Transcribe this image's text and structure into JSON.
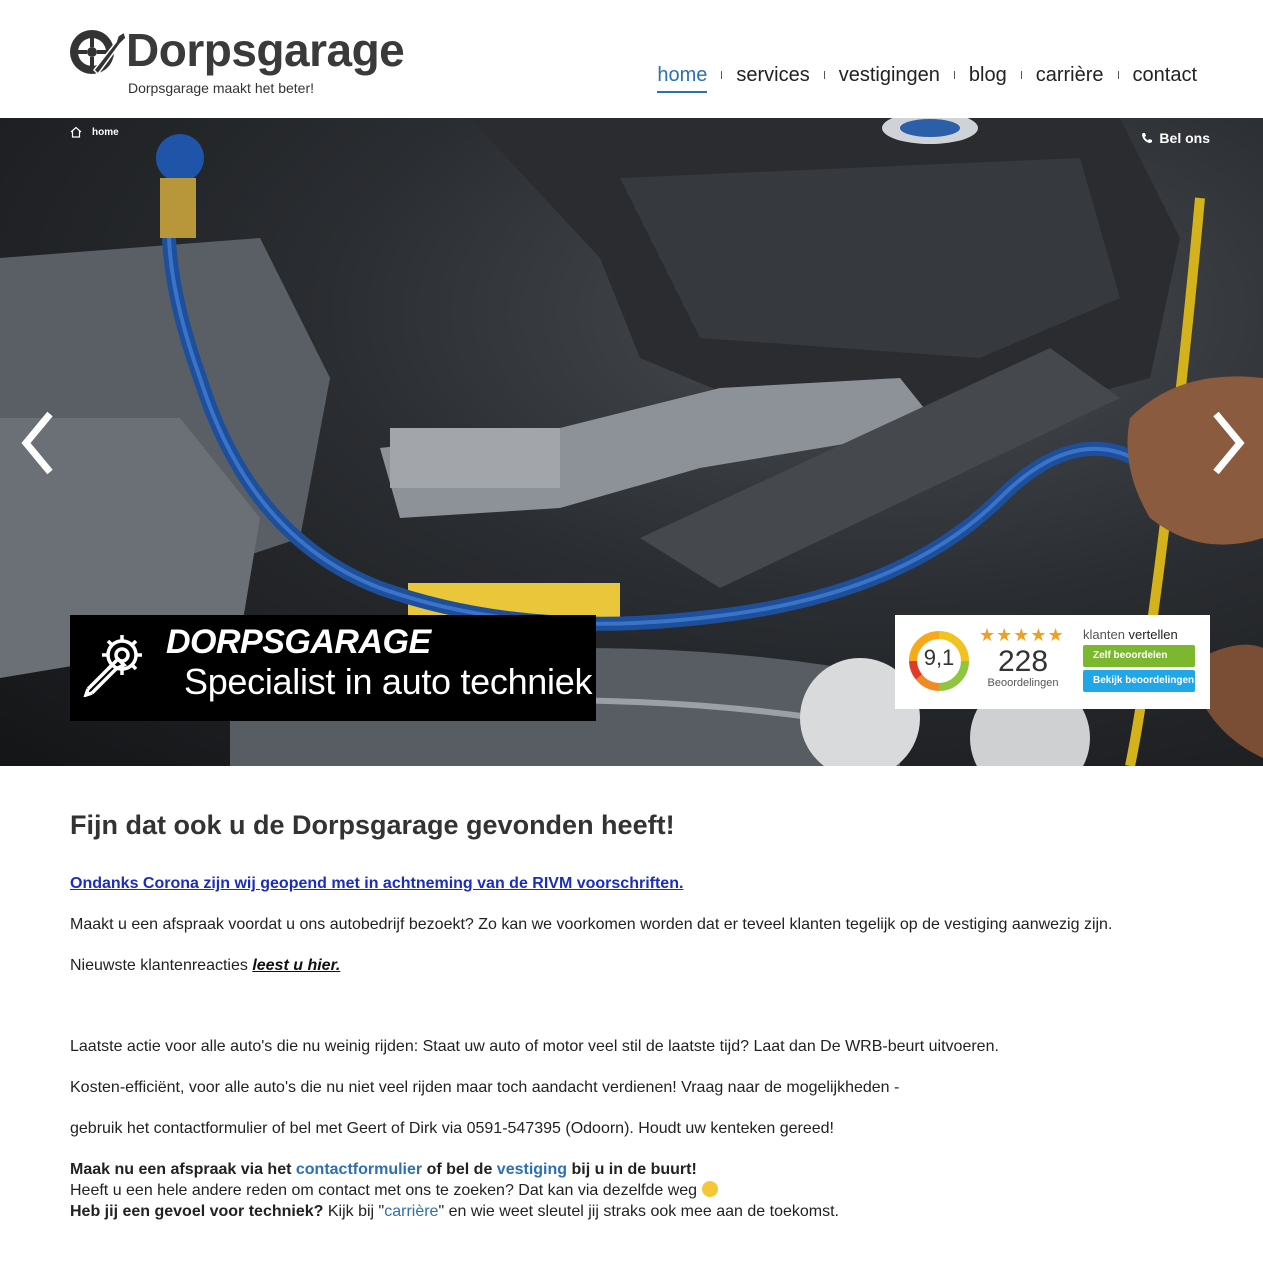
{
  "brand": {
    "name": "Dorpsgarage",
    "tagline": "Dorpsgarage maakt het beter!"
  },
  "nav": {
    "items": [
      {
        "label": "home",
        "active": true
      },
      {
        "label": "services"
      },
      {
        "label": "vestigingen"
      },
      {
        "label": "blog"
      },
      {
        "label": "carrière"
      },
      {
        "label": "contact"
      }
    ]
  },
  "hero": {
    "breadcrumb": "home",
    "call_label": "Bel ons",
    "banner_title": "DORPSGARAGE",
    "banner_subtitle": "Specialist in auto techniek",
    "rating": {
      "score": "9,1",
      "stars": "★★★★★",
      "count": "228",
      "count_label": "Beoordelingen",
      "tag_prefix": "klanten",
      "tag_suffix": "vertellen",
      "btn_review": "Zelf beoordelen",
      "btn_view": "Bekijk beoordelingen"
    }
  },
  "content": {
    "heading": "Fijn dat ook u de Dorpsgarage gevonden heeft!",
    "corona_link": "Ondanks Corona zijn wij geopend met in achtneming van de RIVM voorschriften.",
    "p_appointment": "Maakt u een afspraak voordat u ons autobedrijf bezoekt? Zo kan we voorkomen worden dat er teveel klanten tegelijk op de vestiging aanwezig zijn.",
    "p_reviews_prefix": "Nieuwste klantenreacties ",
    "p_reviews_link": "leest u hier.",
    "p_action": "Laatste actie voor alle auto's die nu weinig rijden: Staat uw auto of motor veel stil de laatste tijd? Laat dan De WRB-beurt uitvoeren.",
    "p_cost": "Kosten-efficiënt, voor alle auto's die nu niet veel rijden maar toch aandacht verdienen! Vraag naar de mogelijkheden -",
    "p_contact": "gebruik het contactformulier of bel met Geert of Dirk via 0591-547395 (Odoorn). Houdt uw kenteken gereed!",
    "cta_1": "Maak nu een afspraak via het ",
    "cta_link_1": "contactformulier",
    "cta_2": " of bel de ",
    "cta_link_2": "vestiging",
    "cta_3": " bij u in de buurt!",
    "other_reason": "Heeft u een hele andere reden om contact met ons te zoeken? Dat kan via dezelfde weg ",
    "tech_bold": "Heb jij een gevoel voor techniek?",
    "tech_1": " Kijk bij \"",
    "tech_link": "carrière",
    "tech_2": "\" en wie weet sleutel jij straks ook mee aan de toekomst."
  },
  "colors": {
    "accent": "#2c6fb3",
    "link": "#1a2dbf",
    "green_button": "#7cb82f",
    "blue_button": "#21a6e8"
  },
  "icons": [
    "wheel-wrench-logo-icon",
    "home-icon",
    "phone-icon",
    "chevron-left-icon",
    "chevron-right-icon",
    "gear-wrench-icon",
    "rating-gauge-icon",
    "wink-emoji-icon"
  ]
}
